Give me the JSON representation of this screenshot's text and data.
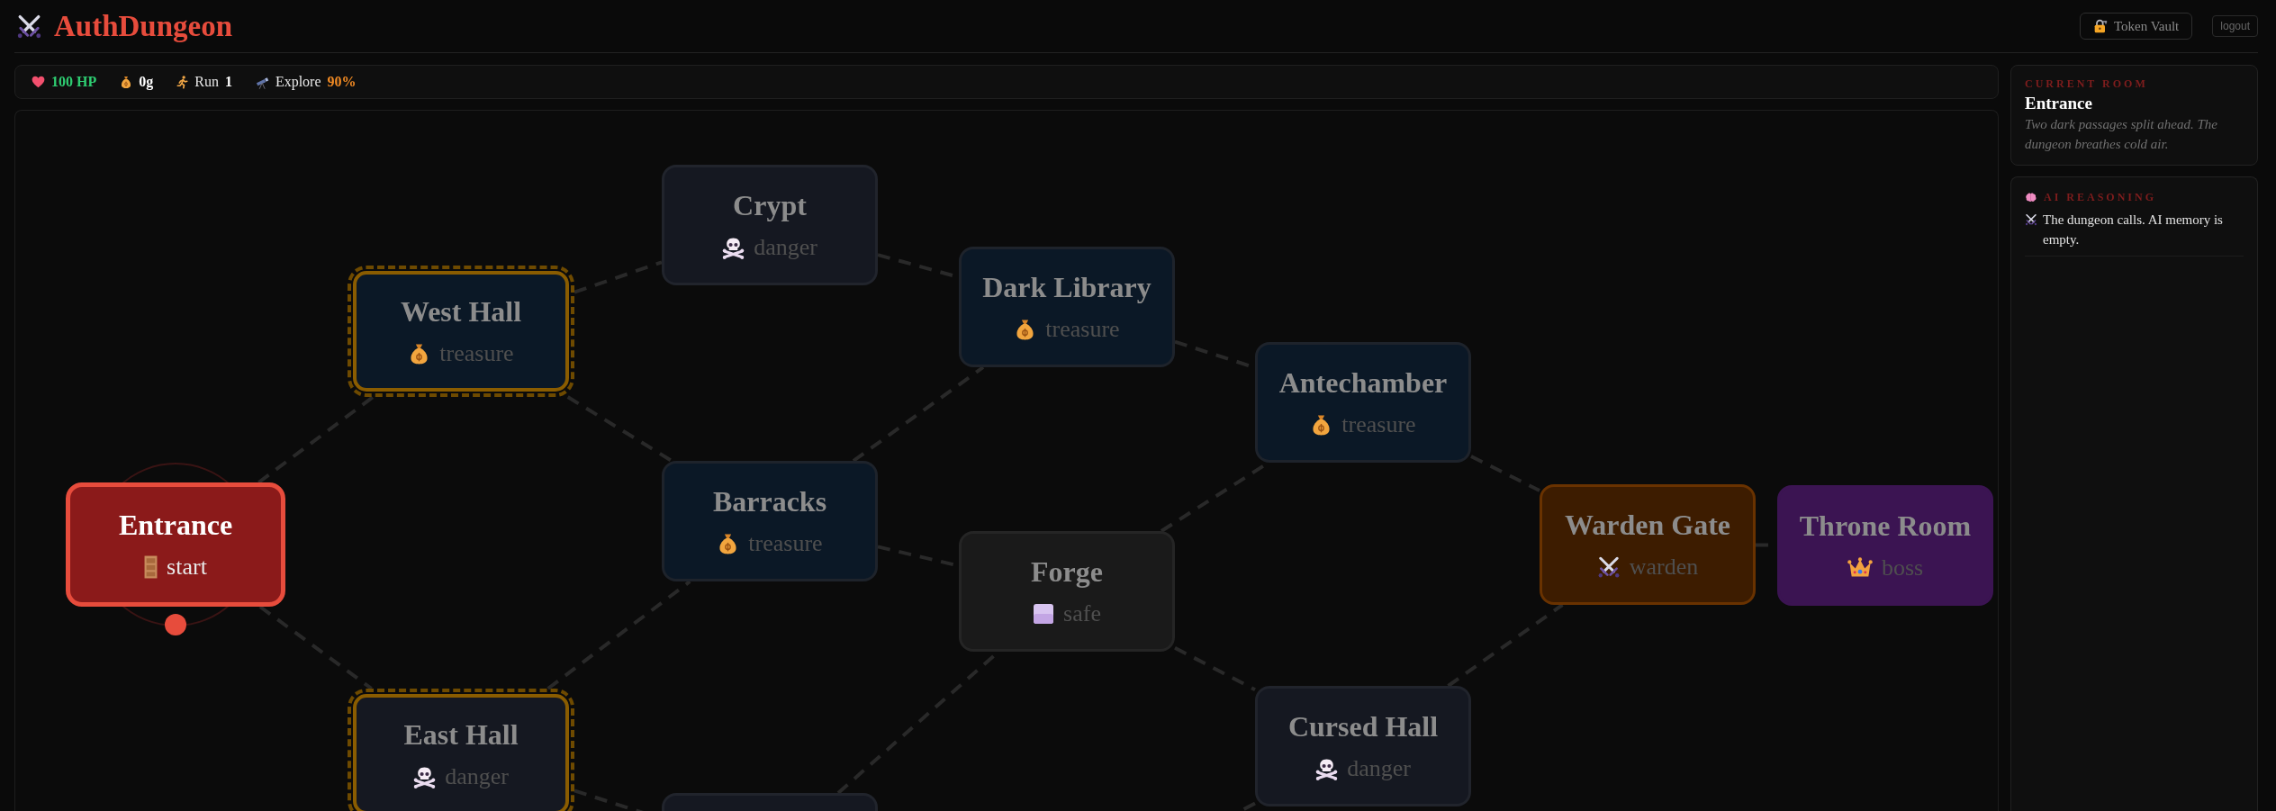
{
  "header": {
    "title": "AuthDungeon",
    "buttons": [
      {
        "kind": "vault",
        "label": "Token Vault"
      },
      {
        "kind": "logout",
        "label": "logout"
      }
    ]
  },
  "stats": [
    {
      "kind": "hp",
      "value": "100 HP"
    },
    {
      "kind": "gold",
      "value": "0g"
    },
    {
      "kind": "run",
      "label": "Run",
      "value": "1"
    },
    {
      "kind": "explore",
      "label": "Explore",
      "value": "90%"
    }
  ],
  "map": {
    "nodes": [
      {
        "name": "Entrance",
        "kind": "start",
        "label": "start",
        "current": true,
        "reachable": false
      },
      {
        "name": "West Hall",
        "kind": "treasure",
        "label": "treasure",
        "current": false,
        "reachable": true
      },
      {
        "name": "East Hall",
        "kind": "danger",
        "label": "danger",
        "current": false,
        "reachable": true
      },
      {
        "name": "Crypt",
        "kind": "danger",
        "label": "danger",
        "current": false,
        "reachable": false
      },
      {
        "name": "Barracks",
        "kind": "treasure",
        "label": "treasure",
        "current": false,
        "reachable": false
      },
      {
        "kind": "danger",
        "current": false,
        "reachable": false
      },
      {
        "name": "Dark Library",
        "kind": "treasure",
        "label": "treasure",
        "current": false,
        "reachable": false
      },
      {
        "name": "Forge",
        "kind": "safe",
        "label": "safe",
        "current": false,
        "reachable": false
      },
      {
        "name": "Antechamber",
        "kind": "treasure",
        "label": "treasure",
        "current": false,
        "reachable": false
      },
      {
        "name": "Cursed Hall",
        "kind": "danger",
        "label": "danger",
        "current": false,
        "reachable": false
      },
      {
        "name": "Warden Gate",
        "kind": "warden",
        "label": "warden",
        "current": false,
        "reachable": false
      },
      {
        "name": "Throne Room",
        "kind": "boss",
        "label": "boss",
        "current": false,
        "reachable": false
      }
    ]
  },
  "sidebar": {
    "current_room": {
      "heading": "CURRENT ROOM",
      "name": "Entrance",
      "description": "Two dark passages split ahead. The dungeon breathes cold air."
    },
    "ai_reasoning": {
      "heading": "AI REASONING",
      "entries": [
        {
          "kind": "system",
          "text": "The dungeon calls. AI memory is empty."
        }
      ]
    }
  }
}
